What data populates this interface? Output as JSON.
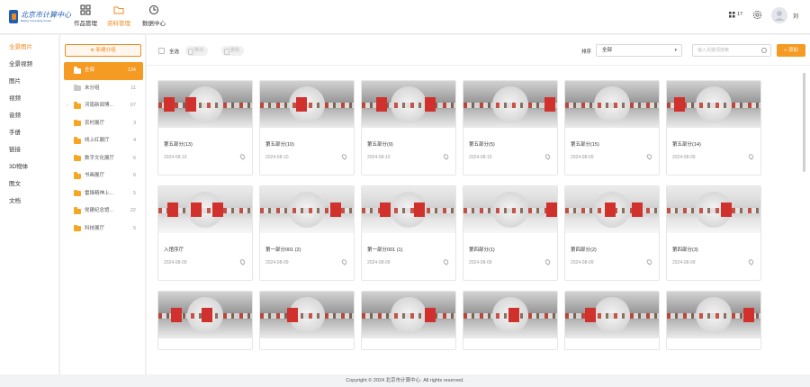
{
  "header": {
    "logo_text": "北京市计算中心",
    "logo_sub": "Beijing Computing Center",
    "nav": [
      {
        "label": "作品管理",
        "icon": "grid-icon"
      },
      {
        "label": "资料管理",
        "icon": "folder-icon"
      },
      {
        "label": "数据中心",
        "icon": "clock-icon"
      }
    ],
    "badge_count": "17",
    "username": "刘"
  },
  "sidebar": {
    "items": [
      "全景图片",
      "全景视频",
      "图片",
      "视频",
      "音频",
      "手册",
      "链接",
      "3D物体",
      "图文",
      "文档"
    ],
    "active": "全景图片"
  },
  "folders": {
    "new_group_label": "新建分组",
    "items": [
      {
        "name": "全部",
        "count": "134"
      },
      {
        "name": "未分组",
        "count": "11"
      },
      {
        "name": "河南新闻博...",
        "count": "67"
      },
      {
        "name": "农村展厅",
        "count": "3"
      },
      {
        "name": "线上红展厅",
        "count": "4"
      },
      {
        "name": "数字文化展厅",
        "count": "6"
      },
      {
        "name": "书画展厅",
        "count": "6"
      },
      {
        "name": "雷锋精神上...",
        "count": "5"
      },
      {
        "name": "党建纪念馆...",
        "count": "22"
      },
      {
        "name": "科技展厅",
        "count": "5"
      }
    ]
  },
  "toolbar": {
    "select_all": "全选",
    "move_label": "移动",
    "delete_label": "删除",
    "sort_label": "排序",
    "sort_value": "全部",
    "search_placeholder": "输入关键词搜索",
    "add_label": "+ 添加"
  },
  "cards": [
    {
      "title": "第五部分(13)",
      "date": "2024-08-10"
    },
    {
      "title": "第五部分(10)",
      "date": "2024-08-10"
    },
    {
      "title": "第五部分(9)",
      "date": "2024-08-10"
    },
    {
      "title": "第五部分(5)",
      "date": "2024-08-10"
    },
    {
      "title": "第五部分(15)",
      "date": "2024-08-09"
    },
    {
      "title": "第五部分(14)",
      "date": "2024-08-09"
    },
    {
      "title": "入馆序厅",
      "date": "2024-08-09"
    },
    {
      "title": "第一部分001 (2)",
      "date": "2024-08-09"
    },
    {
      "title": "第一部分001 (1)",
      "date": "2024-08-09"
    },
    {
      "title": "第四部分(1)",
      "date": "2024-08-09"
    },
    {
      "title": "第四部分(2)",
      "date": "2024-08-09"
    },
    {
      "title": "第四部分(3)",
      "date": "2024-08-09"
    },
    {
      "title": "",
      "date": ""
    },
    {
      "title": "",
      "date": ""
    },
    {
      "title": "",
      "date": ""
    },
    {
      "title": "",
      "date": ""
    },
    {
      "title": "",
      "date": ""
    },
    {
      "title": "",
      "date": ""
    }
  ],
  "footer": {
    "text": "Copyright © 2024 北京市计算中心. All rights reserved."
  },
  "colors": {
    "accent": "#f59a23",
    "brand": "#1f5fb0"
  }
}
